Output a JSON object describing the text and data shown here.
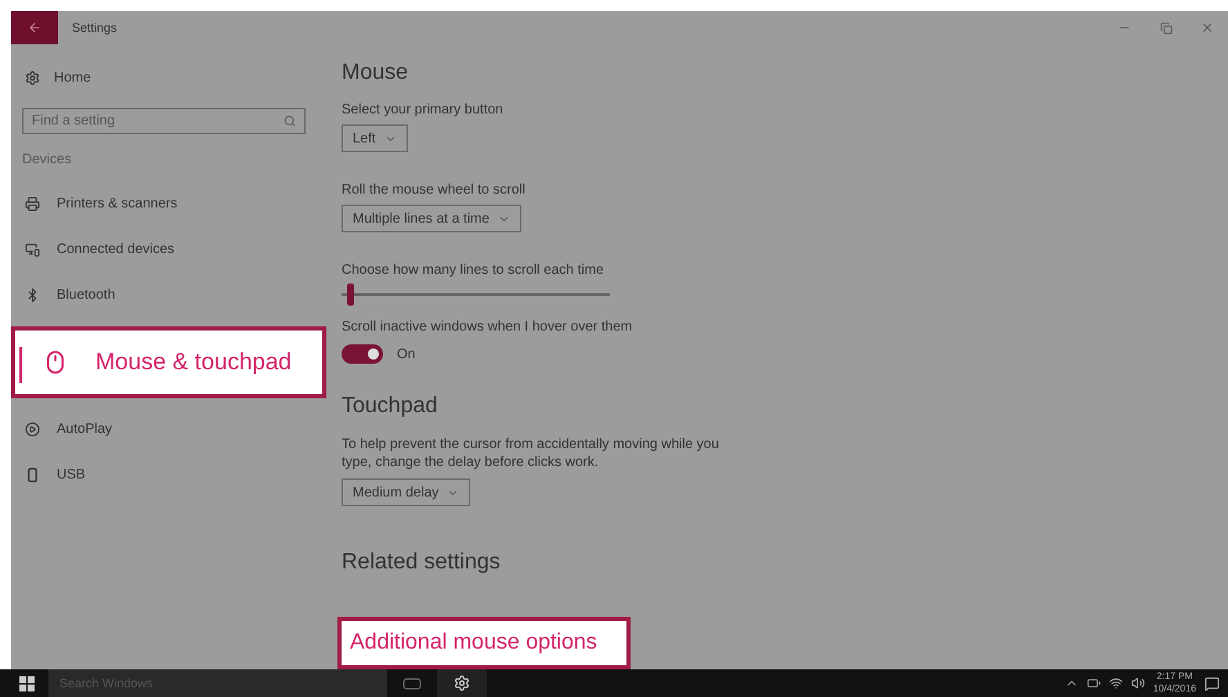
{
  "window": {
    "title": "Settings"
  },
  "sidebar": {
    "home": "Home",
    "search": {
      "placeholder": "Find a setting"
    },
    "section": "Devices",
    "items": [
      {
        "label": "Printers & scanners",
        "kind": "printer",
        "selected": false
      },
      {
        "label": "Connected devices",
        "kind": "devices",
        "selected": false
      },
      {
        "label": "Bluetooth",
        "kind": "bluetooth",
        "selected": false
      },
      {
        "label": "Mouse & touchpad",
        "kind": "mouse",
        "selected": true
      },
      {
        "label": "AutoPlay",
        "kind": "autoplay",
        "selected": false
      },
      {
        "label": "USB",
        "kind": "usb",
        "selected": false
      }
    ]
  },
  "mouse": {
    "heading": "Mouse",
    "primary_button": {
      "label": "Select your primary button",
      "value": "Left"
    },
    "wheel": {
      "label": "Roll the mouse wheel to scroll",
      "value": "Multiple lines at a time"
    },
    "lines": {
      "label": "Choose how many lines to scroll each time",
      "level": 0.03
    },
    "inactive": {
      "label": "Scroll inactive windows when I hover over them",
      "on": true,
      "state": "On"
    }
  },
  "touchpad": {
    "heading": "Touchpad",
    "description": "To help prevent the cursor from accidentally moving while you type, change the delay before clicks work.",
    "delay": "Medium delay"
  },
  "related": {
    "heading": "Related settings",
    "link": "Additional mouse options"
  },
  "taskbar": {
    "search": {
      "placeholder": "Search Windows"
    },
    "time": "2:17 PM",
    "date": "10/4/2016"
  }
}
